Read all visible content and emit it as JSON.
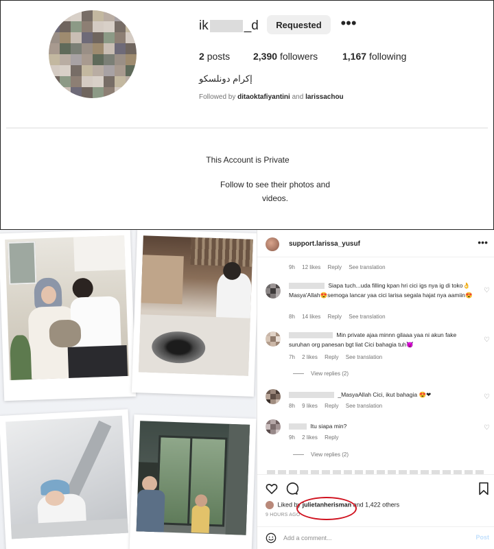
{
  "profile": {
    "username_start": "ik",
    "username_end": "_d",
    "requested_label": "Requested",
    "more_label": "•••",
    "posts_count": "2",
    "posts_label": "posts",
    "followers_count": "2,390",
    "followers_label": "followers",
    "following_count": "1,167",
    "following_label": "following",
    "full_name": "إكرام دونلسكو",
    "followed_by_prefix": "Followed by",
    "followed_by_user1": "ditaoktafiyantini",
    "followed_by_and": "and",
    "followed_by_user2": "larissachou",
    "private_title": "This Account is Private",
    "private_subtitle": "Follow to see their photos and videos."
  },
  "post": {
    "author": "support.larissa_yusuf",
    "more_label": "•••",
    "first_meta": {
      "time": "9h",
      "likes": "12 likes",
      "reply": "Reply",
      "translate": "See translation"
    },
    "comments": [
      {
        "text": "Siapa tuch...uda filling kpan hri cici igs nya ig di toko👌 Masya'Allah😍semoga lancar yaa cici larisa segala hajat nya aamiin😍",
        "time": "8h",
        "likes": "14 likes",
        "reply": "Reply",
        "translate": "See translation"
      },
      {
        "text": "Min private ajaa minnn gilaaa yaa ni akun fake suruhan org panesan bgt liat Cici bahagia tuh😈",
        "time": "7h",
        "likes": "2 likes",
        "reply": "Reply",
        "translate": "See translation",
        "view_replies": "View replies (2)"
      },
      {
        "text": "_MasyaAllah Cici, ikut bahagia 😍❤",
        "time": "8h",
        "likes": "9 likes",
        "reply": "Reply",
        "translate": "See translation"
      },
      {
        "text": "Itu siapa min?",
        "time": "9h",
        "likes": "2 likes",
        "reply": "Reply",
        "view_replies": "View replies (2)"
      }
    ],
    "liked_by_prefix": "Liked by",
    "liked_by_user": "julietanherisman",
    "liked_by_suffix": "and 1,422 others",
    "time_ago": "9 HOURS AGO",
    "add_comment_placeholder": "Add a comment...",
    "post_label": "Post"
  },
  "colors": {
    "highlight_circle": "#d0121f",
    "text_primary": "#262626",
    "text_secondary": "#737373",
    "button_bg": "#efefef"
  },
  "icons": [
    "more-icon",
    "heart-icon",
    "comment-icon",
    "bookmark-icon",
    "emoji-icon",
    "like-heart-icon"
  ]
}
